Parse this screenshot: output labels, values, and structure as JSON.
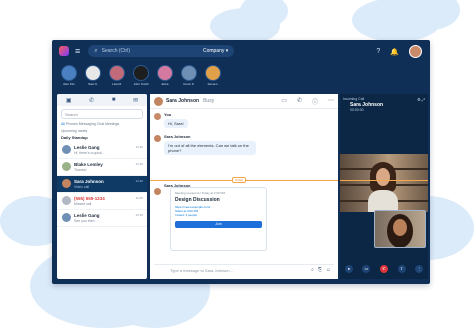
{
  "header": {
    "search_placeholder": "Search (Ctrl)",
    "scope_label": "Company ▾"
  },
  "favorites": [
    {
      "name": "Alex Kim",
      "color": "#4a7fc1"
    },
    {
      "name": "Sam K.",
      "color": "#e8e8e8"
    },
    {
      "name": "Lisa M.",
      "color": "#c06a7a"
    },
    {
      "name": "John Smith",
      "color": "#1e1e1e"
    },
    {
      "name": "Erica",
      "color": "#d47aa0"
    },
    {
      "name": "Kevin S.",
      "color": "#6f8fb5"
    },
    {
      "name": "Jenna L.",
      "color": "#e0a14a"
    }
  ],
  "left": {
    "search_placeholder": "Search",
    "filter_all": "All",
    "filters": "Phones  Messaging  Chat  Meetings",
    "section": "Upcoming meets",
    "meeting": "Daily Standup",
    "items": [
      {
        "name": "Leslie Gang",
        "sub": "Hi, there's a quick...",
        "time": "12:30",
        "color": "#6f8fb5"
      },
      {
        "name": "Blake Lemley",
        "sub": "Thanks!",
        "time": "12:30",
        "color": "#9ab28a"
      },
      {
        "name": "Sara Johnson",
        "sub": "Video call",
        "time": "12:30",
        "color": "#c3855f"
      },
      {
        "name": "(555) 555-1234",
        "sub": "Missed call",
        "time": "11:05",
        "color": "#b0b8c4"
      },
      {
        "name": "Leslie Gang",
        "sub": "See you then",
        "time": "10:45",
        "color": "#6f8fb5"
      }
    ]
  },
  "chat": {
    "header_name": "Sara Johnson",
    "header_status": "Busy",
    "msg1_who": "You",
    "msg1_text": "Hi, Sara!",
    "msg2_who": "Sara Johnson",
    "msg2_text": "I'm out of all the elements. Can we talk on the phone?",
    "timeline_label": "Today",
    "card_who": "Sara Johnson",
    "card_top": "Meeting request for Today at 3:00 PM",
    "card_title": "Design Discussion",
    "card_lines": [
      "https://meet.example.com/...",
      "Starts at 3:00 PM",
      "Invited: 4 people"
    ],
    "card_button": "Join",
    "compose_placeholder": "Type a message to Sara Johnson..."
  },
  "call": {
    "header": "Incoming Call",
    "name": "Sara Johnson",
    "time": "00:00:00"
  }
}
